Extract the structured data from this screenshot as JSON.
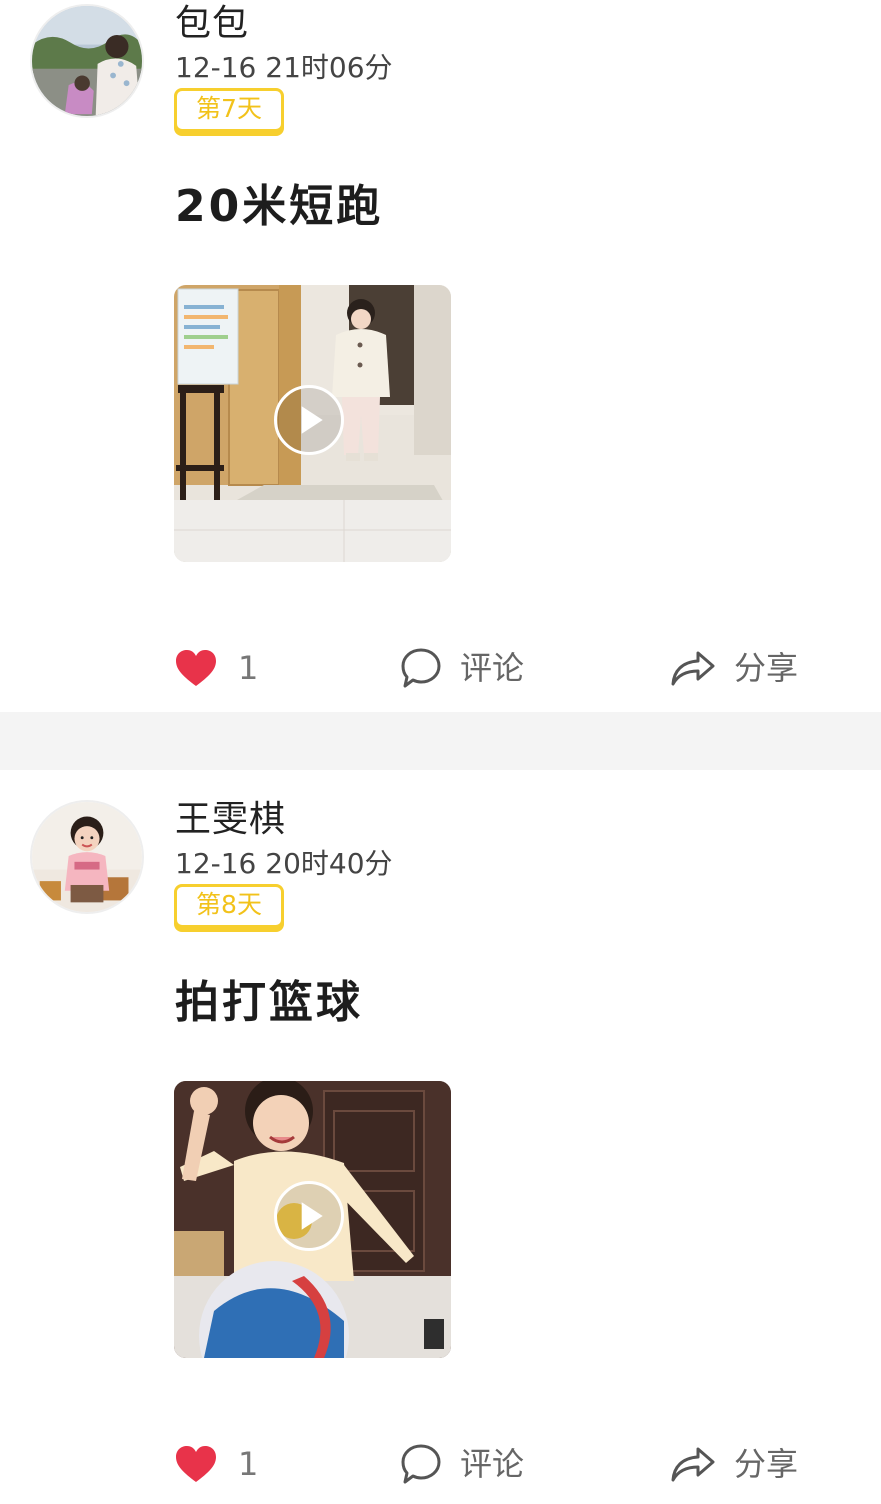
{
  "posts": [
    {
      "username": "包包",
      "timestamp": "12-16 21时06分",
      "day_badge": "第7天",
      "title": "20米短跑",
      "likes": "1",
      "comment_label": "评论",
      "share_label": "分享"
    },
    {
      "username": "王雯棋",
      "timestamp": "12-16 20时40分",
      "day_badge": "第8天",
      "title": "拍打篮球",
      "likes": "1",
      "comment_label": "评论",
      "share_label": "分享"
    }
  ],
  "colors": {
    "badge_yellow": "#f7cf2e",
    "like_red": "#e8334a",
    "divider_gray": "#f4f4f4"
  },
  "icons": {
    "like": "heart-icon",
    "comment": "comment-bubble-icon",
    "share": "share-arrow-icon",
    "play": "play-icon"
  }
}
